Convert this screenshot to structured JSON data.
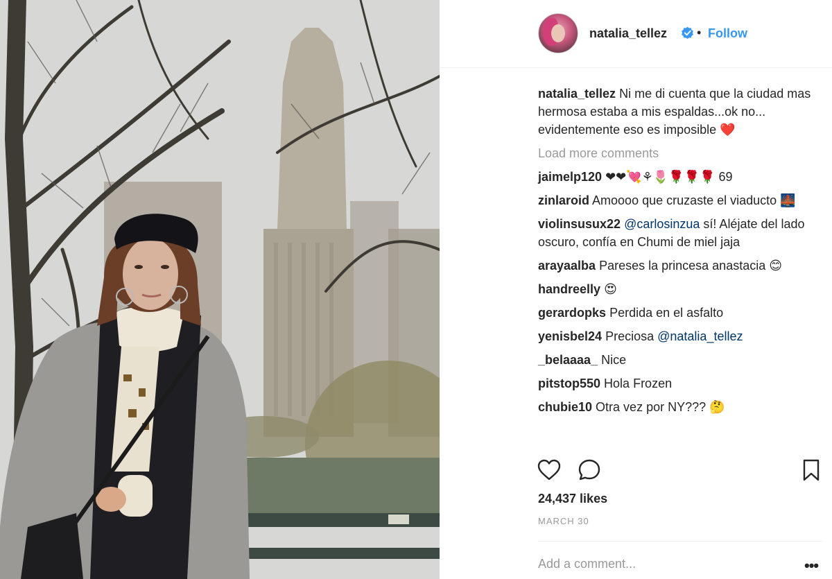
{
  "post": {
    "username": "natalia_tellez",
    "follow_label": "Follow",
    "separator": "•",
    "photo_alt": "Woman in a beret and grey coat standing in Central Park with a tall building behind her"
  },
  "caption": {
    "username": "natalia_tellez",
    "text": "Ni me di cuenta que la ciudad mas hermosa estaba a mis espaldas...ok no... evidentemente eso es imposible ❤️"
  },
  "load_more_label": "Load more comments",
  "comments": [
    {
      "username": "jaimelp120",
      "text": "❤❤💘⚘🌷🌹🌹🌹 69"
    },
    {
      "username": "zinlaroid",
      "text": "Amoooo que cruzaste el viaducto 🌉"
    },
    {
      "username": "violinsusux22",
      "mention": "@carlosinzua",
      "text": "sí! Aléjate del lado oscuro, confía en Chumi de miel jaja"
    },
    {
      "username": "arayaalba",
      "text": "Pareses la princesa anastacia 😊"
    },
    {
      "username": "handreelly",
      "text": "😍"
    },
    {
      "username": "gerardopks",
      "text": "Perdida en el asfalto"
    },
    {
      "username": "yenisbel24",
      "text": "Preciosa",
      "mention": "@natalia_tellez"
    },
    {
      "username": "_belaaaa_",
      "text": "Nice"
    },
    {
      "username": "pitstop550",
      "text": "Hola Frozen"
    },
    {
      "username": "chubie10",
      "text": "Otra vez por NY??? 🤔"
    }
  ],
  "likes_label": "24,437 likes",
  "date_label": "MARCH 30",
  "add_comment_placeholder": "Add a comment...",
  "more_label": "•••",
  "icons": {
    "like": "heart-icon",
    "comment": "comment-icon",
    "save": "bookmark-icon",
    "verified": "verified-badge-icon"
  },
  "colors": {
    "link": "#3897f0",
    "mention": "#003569",
    "muted": "#999999",
    "text": "#262626"
  }
}
